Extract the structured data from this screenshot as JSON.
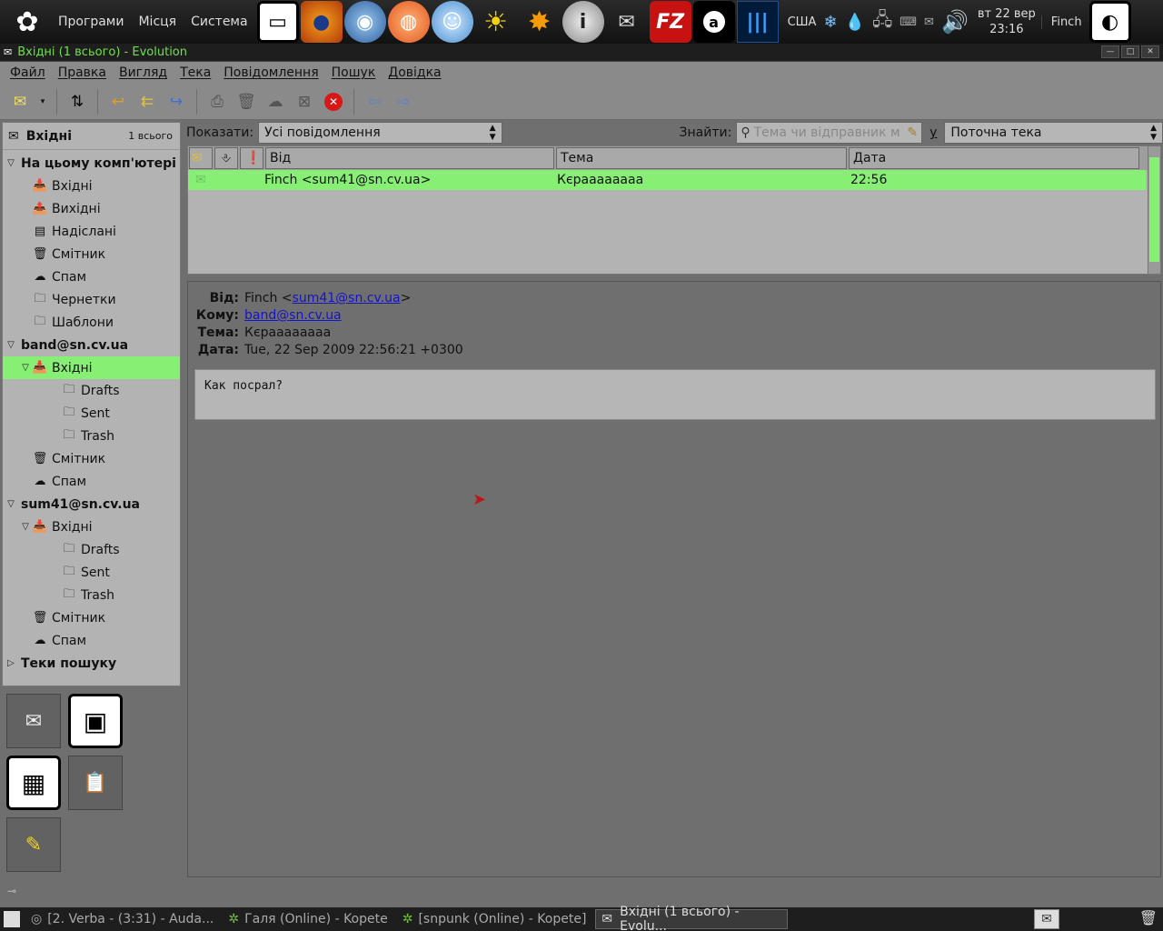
{
  "top_panel": {
    "menus": [
      "Програми",
      "Місця",
      "Система"
    ],
    "layout": "США",
    "clock_day": "вт 22 вер",
    "clock_time": "23:16",
    "user": "Finch"
  },
  "window": {
    "title": "Вхідні (1 всього) - Evolution"
  },
  "menubar": [
    "Файл",
    "Правка",
    "Вигляд",
    "Тека",
    "Повідомлення",
    "Пошук",
    "Довідка"
  ],
  "sidebar": {
    "header": {
      "name": "Вхідні",
      "count": "1 всього"
    },
    "tree": [
      {
        "label": "На цьому комп'ютері",
        "level": 0,
        "group": true,
        "icon": "expanded"
      },
      {
        "label": "Вхідні",
        "level": 1,
        "icon": "inbox-icon"
      },
      {
        "label": "Вихідні",
        "level": 1,
        "icon": "outbox-icon"
      },
      {
        "label": "Надіслані",
        "level": 1,
        "icon": "sent-icon"
      },
      {
        "label": "Смітник",
        "level": 1,
        "icon": "trash-icon"
      },
      {
        "label": "Спам",
        "level": 1,
        "icon": "junk-icon"
      },
      {
        "label": "Чернетки",
        "level": 1,
        "icon": "folder-icon"
      },
      {
        "label": "Шаблони",
        "level": 1,
        "icon": "folder-icon"
      },
      {
        "label": "band@sn.cv.ua",
        "level": 0,
        "group": true,
        "icon": "expanded"
      },
      {
        "label": "Вхідні",
        "level": 1,
        "icon": "inbox-icon",
        "selected": true,
        "expander": true
      },
      {
        "label": "Drafts",
        "level": 2,
        "icon": "folder-icon"
      },
      {
        "label": "Sent",
        "level": 2,
        "icon": "folder-icon"
      },
      {
        "label": "Trash",
        "level": 2,
        "icon": "folder-icon"
      },
      {
        "label": "Смітник",
        "level": 1,
        "icon": "trash-icon"
      },
      {
        "label": "Спам",
        "level": 1,
        "icon": "junk-icon"
      },
      {
        "label": "sum41@sn.cv.ua",
        "level": 0,
        "group": true,
        "icon": "expanded"
      },
      {
        "label": "Вхідні",
        "level": 1,
        "icon": "inbox-icon",
        "expander": true
      },
      {
        "label": "Drafts",
        "level": 2,
        "icon": "folder-icon"
      },
      {
        "label": "Sent",
        "level": 2,
        "icon": "folder-icon"
      },
      {
        "label": "Trash",
        "level": 2,
        "icon": "folder-icon"
      },
      {
        "label": "Смітник",
        "level": 1,
        "icon": "trash-icon"
      },
      {
        "label": "Спам",
        "level": 1,
        "icon": "junk-icon"
      },
      {
        "label": "Теки пошуку",
        "level": 0,
        "group": true,
        "icon": "collapsed"
      }
    ]
  },
  "filter": {
    "show_label": "Показати:",
    "show_value": "Усі повідомлення",
    "find_label": "Знайти:",
    "find_placeholder": "Тема чи відправник м",
    "in_label": "у",
    "scope_value": "Поточна тека"
  },
  "message_list": {
    "columns": [
      "Від",
      "Тема",
      "Дата"
    ],
    "rows": [
      {
        "from": "Finch <sum41@sn.cv.ua>",
        "subject": "Кєраааааааа",
        "date": "22:56"
      }
    ]
  },
  "preview": {
    "from_label": "Від:",
    "from_name": "Finch <",
    "from_email": "sum41@sn.cv.ua",
    "from_close": ">",
    "to_label": "Кому:",
    "to_email": "band@sn.cv.ua",
    "subject_label": "Тема:",
    "subject": "Кєраааааааа",
    "date_label": "Дата:",
    "date": "Tue, 22 Sep 2009 22:56:21 +0300",
    "body": "Как посрал?"
  },
  "taskbar": [
    {
      "label": "[2. Verba -  (3:31) - Auda...",
      "active": false
    },
    {
      "label": "Галя (Online) - Kopete",
      "active": false
    },
    {
      "label": "[snpunk (Online) - Kopete]",
      "active": false
    },
    {
      "label": "Вхідні (1 всього) - Evolu...",
      "active": true
    }
  ],
  "colors": {
    "selection": "#86ef74",
    "title_text": "#6fe04c",
    "link": "#1414c8"
  }
}
